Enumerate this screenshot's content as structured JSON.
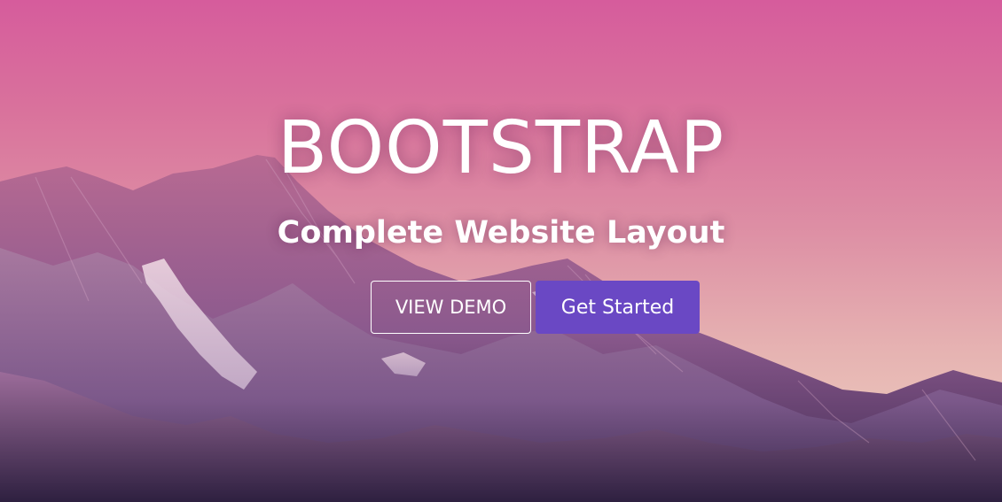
{
  "hero": {
    "title": "BOOTSTRAP",
    "subtitle": "Complete Website Layout",
    "buttons": {
      "view_demo": "VIEW DEMO",
      "get_started": "Get Started"
    }
  },
  "colors": {
    "sky_top": "#d65c9c",
    "sky_bottom": "#efd4c2",
    "primary_button": "#6a48c4",
    "text": "#ffffff"
  }
}
